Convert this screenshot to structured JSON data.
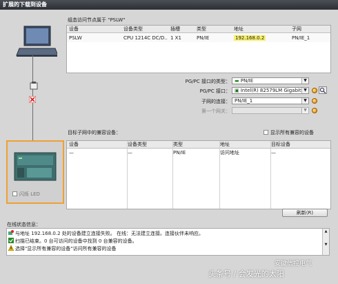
{
  "window": {
    "title": "扩展的下载到设备"
  },
  "configured": {
    "caption": "组态访问节点属于 \"PSLW\"",
    "columns": [
      "设备",
      "设备类型",
      "插槽",
      "类型",
      "地址",
      "子网"
    ],
    "row": [
      "PSLW",
      "CPU 1214C DC/D...",
      "1 X1",
      "PN/IE",
      "192.168.0.2",
      "PN/IE_1"
    ]
  },
  "interface": {
    "type_label": "PG/PC 接口的类型：",
    "type_value": "PN/IE",
    "iface_label": "PG/PC 接口：",
    "iface_value": "Intel(R) 82579LM Gigabit...",
    "subnet_label": "子网的连接：",
    "subnet_value": "PN/IE_1",
    "gateway_label": "第一个网关：",
    "gateway_value": ""
  },
  "compatible": {
    "caption": "目标子网中的兼容设备：",
    "show_all_label": "显示所有兼容的设备",
    "columns": [
      "设备",
      "设备类型",
      "类型",
      "地址",
      "目标设备"
    ],
    "row": [
      "—",
      "—",
      "PN/IE",
      "访问地址",
      "—"
    ]
  },
  "flash_led_label": "闪烁 LED",
  "refresh_label": "刷新(R)",
  "status": {
    "caption": "在线状态信息：",
    "messages": [
      "与地址 192.168.0.2 处的设备建立连接失败。 在线：无法建立连接。连接伙伴未响应。",
      "扫描已结束。0 台可访问的设备中找到 0 台兼容的设备。",
      "选择\"显示所有兼容的设备\"访问所有兼容的设备"
    ]
  },
  "watermark": "头条号 / 会发光的太阳",
  "watermark2": "安徽信控电气",
  "colors": {
    "accent_orange": "#f0a030",
    "highlight": "#f7f06a",
    "error": "#d22",
    "ok": "#2a8a2a",
    "warn": "#e8b400"
  }
}
